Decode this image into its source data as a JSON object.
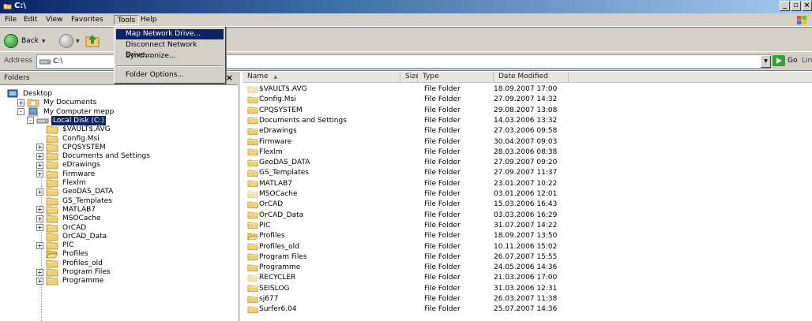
{
  "window": {
    "title": "C:\\"
  },
  "menubar": {
    "items": [
      "File",
      "Edit",
      "View",
      "Favorites",
      "Tools",
      "Help"
    ]
  },
  "toolbar": {
    "back_label": "Back"
  },
  "addressbar": {
    "label": "Address",
    "value": "C:\\",
    "go_label": "Go",
    "links_label": "Link"
  },
  "tools_menu": {
    "items": [
      "Map Network Drive...",
      "Disconnect Network Drive...",
      "Synchronize...",
      "Folder Options..."
    ],
    "highlighted": "Map Network Drive..."
  },
  "folders_pane": {
    "title": "Folders",
    "close": "×",
    "tree": [
      {
        "label": "Desktop"
      },
      {
        "label": "My Documents"
      },
      {
        "label": "My Computer mepp"
      },
      {
        "label": "Local Disk (C:)"
      },
      {
        "label": "$VAULT$.AVG"
      },
      {
        "label": "Config.Msi"
      },
      {
        "label": "CPQSYSTEM"
      },
      {
        "label": "Documents and Settings"
      },
      {
        "label": "eDrawings"
      },
      {
        "label": "Firmware"
      },
      {
        "label": "Flexlm"
      },
      {
        "label": "GeoDAS_DATA"
      },
      {
        "label": "GS_Templates"
      },
      {
        "label": "MATLAB7"
      },
      {
        "label": "MSOCache"
      },
      {
        "label": "OrCAD"
      },
      {
        "label": "OrCAD_Data"
      },
      {
        "label": "PIC"
      },
      {
        "label": "Profiles"
      },
      {
        "label": "Profiles_old"
      },
      {
        "label": "Program Files"
      },
      {
        "label": "Programme"
      }
    ]
  },
  "file_list": {
    "columns": {
      "name": "Name",
      "size": "Size",
      "type": "Type",
      "date": "Date Modified"
    },
    "sort_indicator": "▲",
    "rows": [
      {
        "name": "$VAULT$.AVG",
        "type": "File Folder",
        "date": "18.09.2007 17:00"
      },
      {
        "name": "Config.Msi",
        "type": "File Folder",
        "date": "27.09.2007 14:32"
      },
      {
        "name": "CPQSYSTEM",
        "type": "File Folder",
        "date": "29.08.2007 13:08"
      },
      {
        "name": "Documents and Settings",
        "type": "File Folder",
        "date": "14.03.2006 13:32"
      },
      {
        "name": "eDrawings",
        "type": "File Folder",
        "date": "27.03.2006 09:58"
      },
      {
        "name": "Firmware",
        "type": "File Folder",
        "date": "30.04.2007 09:03"
      },
      {
        "name": "Flexlm",
        "type": "File Folder",
        "date": "28.03.2006 08:38"
      },
      {
        "name": "GeoDAS_DATA",
        "type": "File Folder",
        "date": "27.09.2007 09:20"
      },
      {
        "name": "GS_Templates",
        "type": "File Folder",
        "date": "27.09.2007 11:37"
      },
      {
        "name": "MATLAB7",
        "type": "File Folder",
        "date": "23.01.2007 10:22"
      },
      {
        "name": "MSOCache",
        "type": "File Folder",
        "date": "03.01.2006 12:01"
      },
      {
        "name": "OrCAD",
        "type": "File Folder",
        "date": "15.03.2006 16:43"
      },
      {
        "name": "OrCAD_Data",
        "type": "File Folder",
        "date": "03.03.2006 16:29"
      },
      {
        "name": "PIC",
        "type": "File Folder",
        "date": "31.07.2007 14:22"
      },
      {
        "name": "Profiles",
        "type": "File Folder",
        "date": "18.09.2007 13:50"
      },
      {
        "name": "Profiles_old",
        "type": "File Folder",
        "date": "10.11.2006 15:02"
      },
      {
        "name": "Program Files",
        "type": "File Folder",
        "date": "26.07.2007 15:55"
      },
      {
        "name": "Programme",
        "type": "File Folder",
        "date": "24.05.2006 14:36"
      },
      {
        "name": "RECYCLER",
        "type": "File Folder",
        "date": "21.03.2006 17:00"
      },
      {
        "name": "SEISLOG",
        "type": "File Folder",
        "date": "31.03.2006 12:31"
      },
      {
        "name": "sj677",
        "type": "File Folder",
        "date": "26.03.2007 11:38"
      },
      {
        "name": "Surfer6.04",
        "type": "File Folder",
        "date": "25.07.2007 14:36"
      }
    ]
  },
  "colors": {
    "titlebar": "#0a246a",
    "folder": "#f0d070",
    "selection": "#0a246a",
    "chrome": "#d4d0c8"
  }
}
